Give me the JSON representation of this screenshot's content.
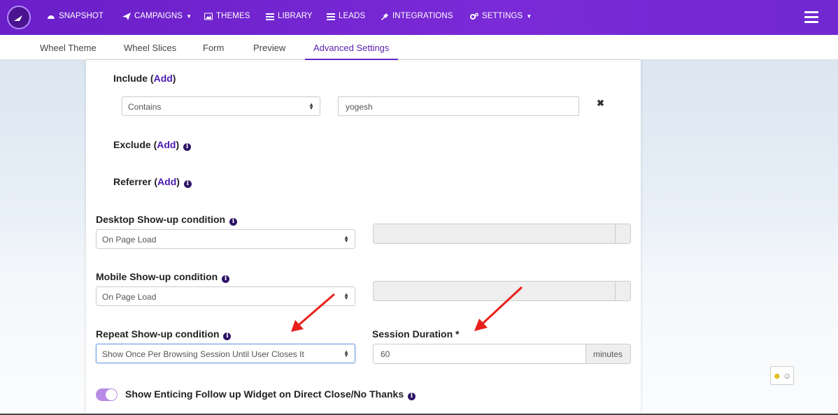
{
  "nav": {
    "items": [
      {
        "label": "SNAPSHOT",
        "icon": "dashboard-icon"
      },
      {
        "label": "CAMPAIGNS",
        "icon": "paper-plane-icon",
        "caret": true
      },
      {
        "label": "THEMES",
        "icon": "image-icon"
      },
      {
        "label": "LIBRARY",
        "icon": "list-icon"
      },
      {
        "label": "LEADS",
        "icon": "list-icon"
      },
      {
        "label": "INTEGRATIONS",
        "icon": "plug-icon"
      },
      {
        "label": "SETTINGS",
        "icon": "gears-icon",
        "caret": true
      }
    ]
  },
  "tabs": [
    "Wheel Theme",
    "Wheel Slices",
    "Form",
    "Preview",
    "Advanced Settings"
  ],
  "active_tab": "Advanced Settings",
  "include": {
    "label": "Include",
    "add": "Add",
    "rule_select": "Contains",
    "rule_value": "yogesh"
  },
  "exclude": {
    "label": "Exclude",
    "add": "Add"
  },
  "referrer": {
    "label": "Referrer",
    "add": "Add"
  },
  "desktop": {
    "label": "Desktop Show-up condition",
    "value": "On Page Load"
  },
  "mobile": {
    "label": "Mobile Show-up condition",
    "value": "On Page Load"
  },
  "repeat": {
    "label": "Repeat Show-up condition",
    "value": "Show Once Per Browsing Session Until User Closes It"
  },
  "session": {
    "label": "Session Duration *",
    "value": "60",
    "unit": "minutes"
  },
  "followup": {
    "label": "Show Enticing Follow up Widget on Direct Close/No Thanks",
    "enabled": true
  },
  "colors": {
    "brand": "#6a1fc8",
    "link": "#4a1ab0",
    "arrow": "#e8201c"
  }
}
